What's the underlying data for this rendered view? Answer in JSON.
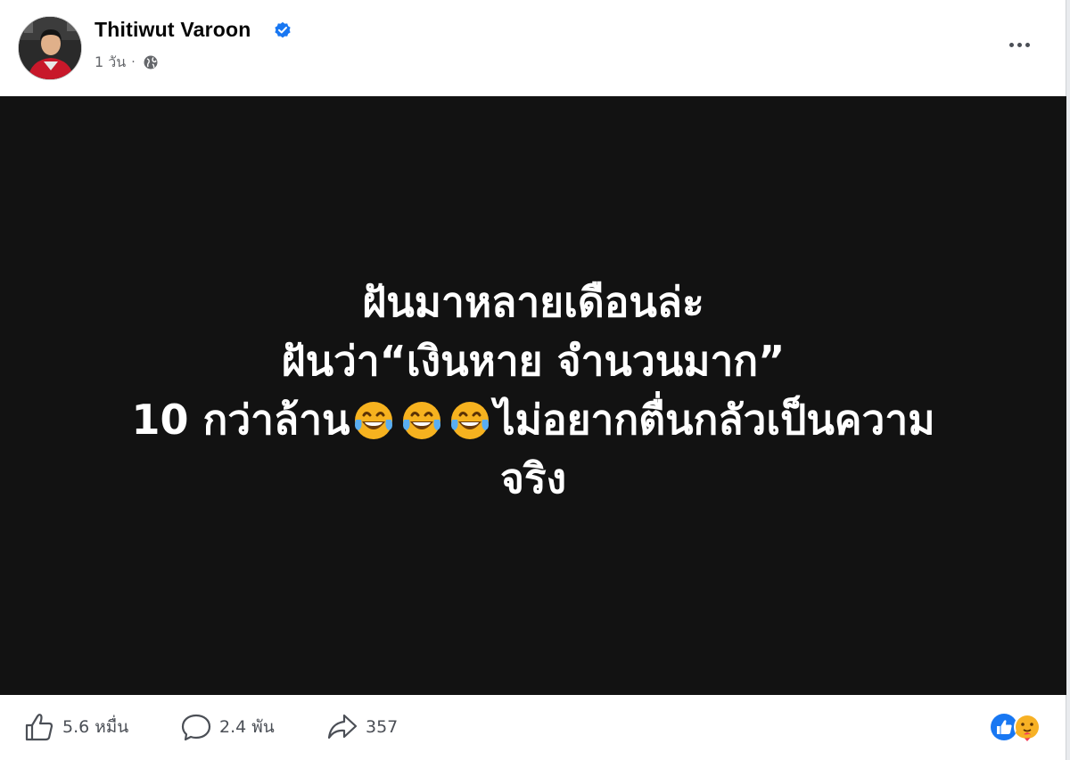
{
  "post": {
    "author": "Thitiwut Varoon",
    "verified": true,
    "timestamp": "1 วัน",
    "separator": "·",
    "privacy_icon": "globe-icon",
    "more_icon": "more-horizontal-icon"
  },
  "media": {
    "background": "#121212",
    "line1": "ฝันมาหลายเดือนล่ะ",
    "line2": "ฝันว่า“เงินหาย จำนวนมาก”",
    "line3_prefix": "10 กว่าล้าน",
    "line3_emojis": "😂😂😂",
    "line3_suffix": "ไม่อยากตื่นกลัวเป็นความ",
    "line4": "จริง"
  },
  "actions": {
    "likes": "5.6 หมื่น",
    "comments": "2.4 พัน",
    "shares": "357",
    "reaction_icons": [
      "like-reaction-icon",
      "care-reaction-icon"
    ]
  },
  "colors": {
    "verified_blue": "#1877f2",
    "like_blue": "#1877f2",
    "text_secondary": "#65676b"
  }
}
